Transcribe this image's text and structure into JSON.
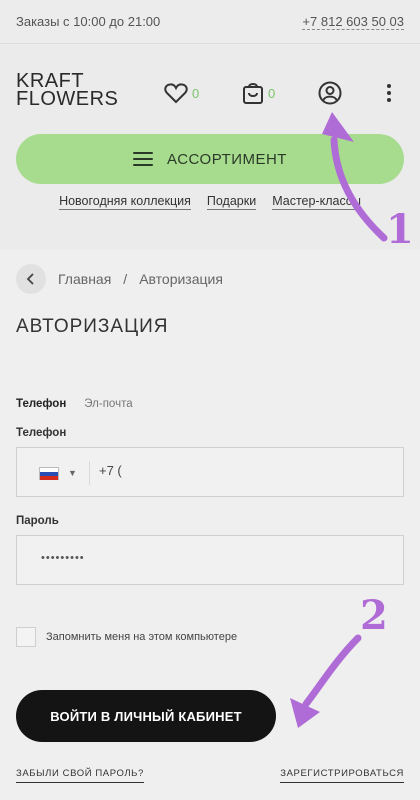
{
  "topbar": {
    "hours": "Заказы с 10:00 до 21:00",
    "phone": "+7 812 603 50 03"
  },
  "header": {
    "logo_line1": "KRAFT",
    "logo_line2": "FLOWERS",
    "favorites_count": "0",
    "cart_count": "0",
    "assortment_label": "АССОРТИМЕНТ",
    "nav": [
      "Новогодняя коллекция",
      "Подарки",
      "Мастер-классы"
    ]
  },
  "annotations": {
    "marker1": "1",
    "marker2": "2",
    "color": "#b06cd6"
  },
  "breadcrumb": {
    "home": "Главная",
    "separator": "/",
    "current": "Авторизация"
  },
  "page": {
    "title": "АВТОРИЗАЦИЯ"
  },
  "login_form": {
    "tabs": [
      "Телефон",
      "Эл-почта"
    ],
    "active_tab": "Телефон",
    "phone_label": "Телефон",
    "phone_value": "+7 (",
    "password_label": "Пароль",
    "password_value": "•••••••••",
    "remember_label": "Запомнить меня на этом компьютере",
    "submit_label": "ВОЙТИ В ЛИЧНЫЙ КАБИНЕТ",
    "forgot_label": "ЗАБЫЛИ СВОЙ ПАРОЛЬ?",
    "register_label": "ЗАРЕГИСТРИРОВАТЬСЯ"
  },
  "colors": {
    "accent_green": "#a7dc8e",
    "count_green": "#7cc36a",
    "button_dark": "#141414"
  }
}
